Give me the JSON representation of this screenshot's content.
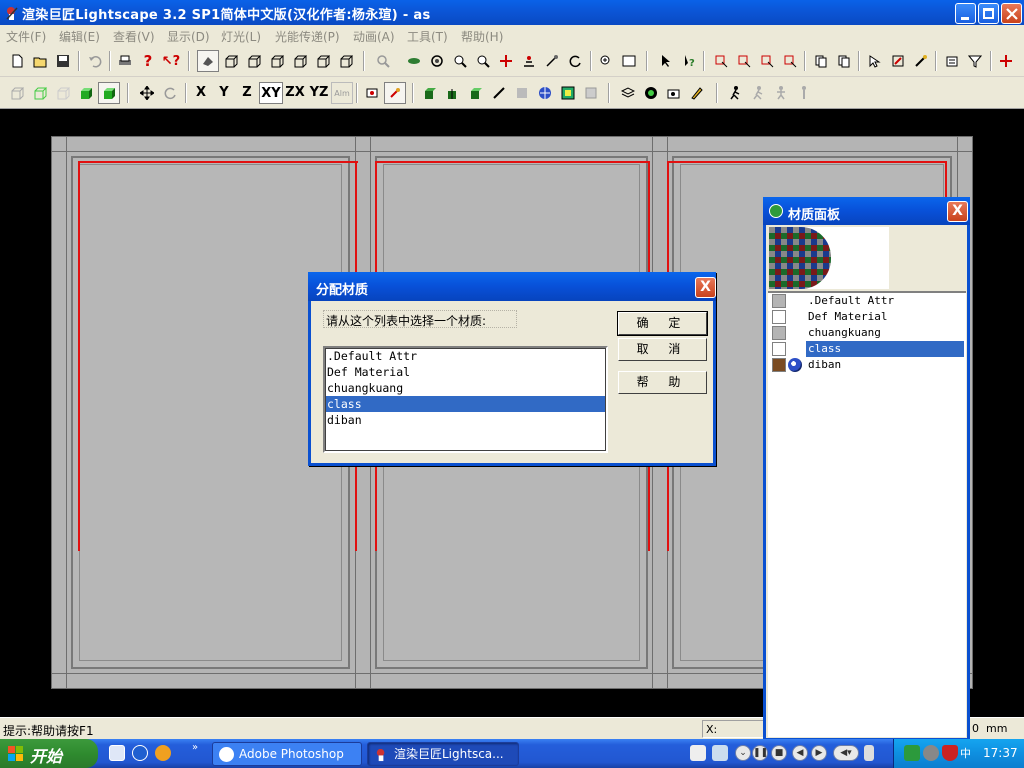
{
  "window": {
    "title": "渲染巨匠Lightscape 3.2 SP1简体中文版(汉化作者:杨永瑄) - as"
  },
  "menu": [
    "文件(F)",
    "编辑(E)",
    "查看(V)",
    "显示(D)",
    "灯光(L)",
    "光能传递(P)",
    "动画(A)",
    "工具(T)",
    "帮助(H)"
  ],
  "toolbar2_labels": [
    "X",
    "Y",
    "Z",
    "XY",
    "ZX",
    "YZ",
    "Alm"
  ],
  "statusbar": {
    "hint": "提示:帮助请按F1",
    "coord_label": "X:",
    "unit_digit": "0",
    "unit": "mm"
  },
  "dialog": {
    "title": "分配材质",
    "close": "X",
    "prompt": "请从这个列表中选择一个材质:",
    "items": [
      ".Default Attr",
      "Def Material",
      "chuangkuang",
      "class",
      "diban"
    ],
    "selected_index": 3,
    "buttons": {
      "ok": "确 定",
      "cancel": "取 消",
      "help": "帮 助"
    }
  },
  "material_panel": {
    "title": "材质面板",
    "close": "X",
    "items": [
      {
        "name": ".Default Attr",
        "swatch": "#b4b4b4"
      },
      {
        "name": "Def Material",
        "swatch": "#ffffff"
      },
      {
        "name": "chuangkuang",
        "swatch": "#b4b4b4"
      },
      {
        "name": "class",
        "swatch": "#ffffff"
      },
      {
        "name": "diban",
        "swatch": "#7a4b22"
      }
    ],
    "selected_index": 3
  },
  "taskbar": {
    "start": "开始",
    "tasks": [
      "Adobe Photoshop",
      "渲染巨匠Lightsca..."
    ],
    "clock": "17:37"
  },
  "colors": {
    "titlebar": "#0a5ce4",
    "selection": "#316ac5",
    "frame_red": "#e11010",
    "scene_gray": "#b4b4b4"
  }
}
